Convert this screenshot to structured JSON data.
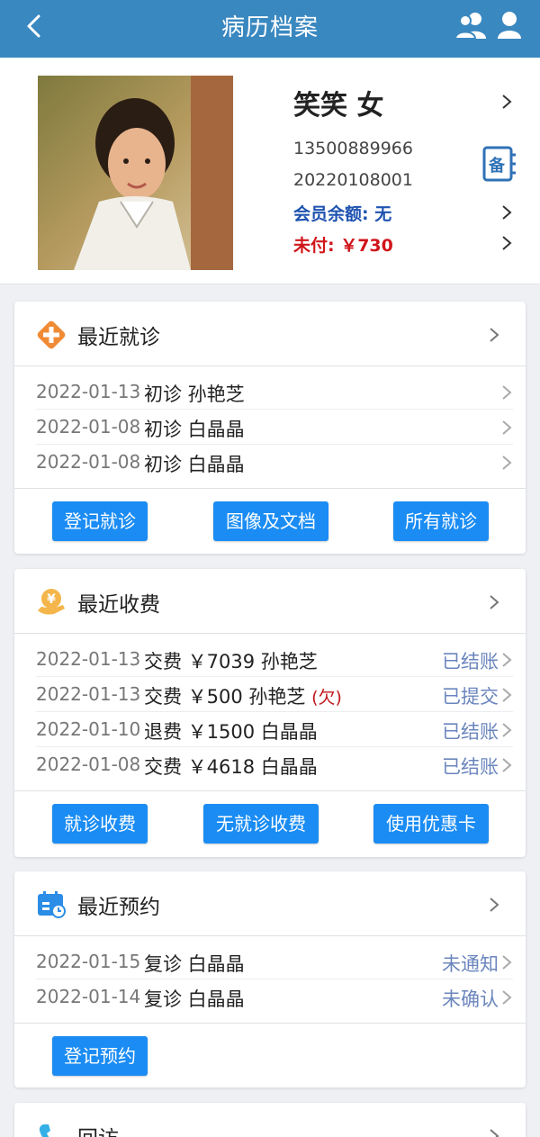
{
  "header": {
    "title": "病历档案"
  },
  "patient": {
    "name": "笑笑 女",
    "phone": "13500889966",
    "record_no": "20220108001",
    "balance": "会员余额: 无",
    "unpaid": "未付: ￥730",
    "note_label": "备"
  },
  "visits": {
    "title": "最近就诊",
    "rows": [
      {
        "date": "2022-01-13",
        "desc": "初诊 孙艳芝"
      },
      {
        "date": "2022-01-08",
        "desc": "初诊 白晶晶"
      },
      {
        "date": "2022-01-08",
        "desc": "初诊 白晶晶"
      }
    ],
    "buttons": [
      "登记就诊",
      "图像及文档",
      "所有就诊"
    ]
  },
  "charges": {
    "title": "最近收费",
    "rows": [
      {
        "date": "2022-01-13",
        "desc": "交费 ￥7039 孙艳芝",
        "extra": "",
        "status": "已结账"
      },
      {
        "date": "2022-01-13",
        "desc": "交费 ￥500 孙艳芝",
        "extra": "(欠)",
        "status": "已提交"
      },
      {
        "date": "2022-01-10",
        "desc": "退费 ￥1500 白晶晶",
        "extra": "",
        "status": "已结账"
      },
      {
        "date": "2022-01-08",
        "desc": "交费 ￥4618 白晶晶",
        "extra": "",
        "status": "已结账"
      }
    ],
    "buttons": [
      "就诊收费",
      "无就诊收费",
      "使用优惠卡"
    ]
  },
  "appointments": {
    "title": "最近预约",
    "rows": [
      {
        "date": "2022-01-15",
        "desc": "复诊 白晶晶",
        "status": "未通知"
      },
      {
        "date": "2022-01-14",
        "desc": "复诊 白晶晶",
        "status": "未确认"
      }
    ],
    "buttons": [
      "登记预约"
    ]
  },
  "followup": {
    "title": "回访"
  },
  "colors": {
    "header": "#3a88c0",
    "button": "#1a8cf4",
    "balance": "#1f53b0",
    "unpaid": "#d0161b",
    "status": "#6b86bd"
  },
  "icons": [
    "back-icon",
    "users-icon",
    "user-icon",
    "chevron-right-icon",
    "note-icon",
    "plus-cross-icon",
    "yuan-coin-icon",
    "calendar-icon",
    "phone-icon"
  ]
}
